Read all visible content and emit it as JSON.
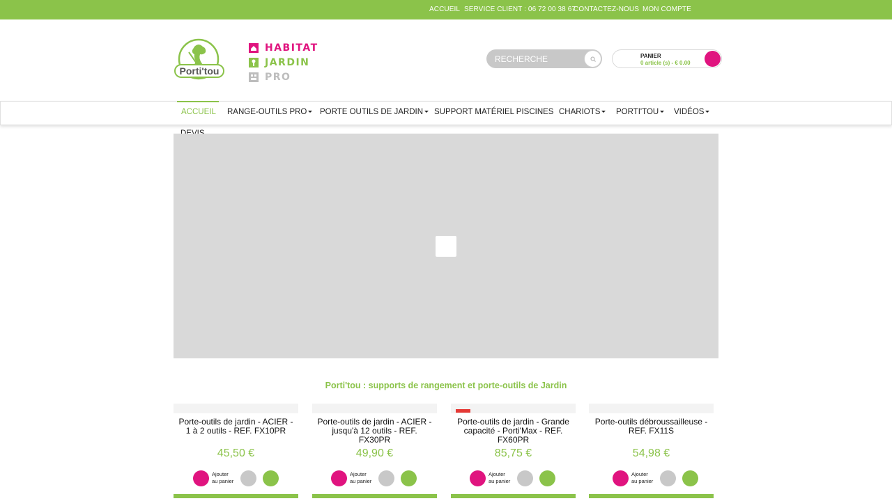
{
  "topbar": {
    "home": "ACCUEIL",
    "service": "SERVICE CLIENT : 06 72 00 38 67",
    "contact": "CONTACTEZ-NOUS",
    "account": "MON COMPTE"
  },
  "logo": {
    "text": "Porti'tou"
  },
  "univers": [
    {
      "label": "HABITAT",
      "color": "#e0147f",
      "icon": "house-icon"
    },
    {
      "label": "JARDIN",
      "color": "#8bc34a",
      "icon": "garden-icon"
    },
    {
      "label": "PRO",
      "color": "#bdbdbd",
      "icon": "building-icon"
    }
  ],
  "search": {
    "placeholder": "RECHERCHE"
  },
  "cart": {
    "title": "PANIER",
    "summary": "0 article (s) - € 0.00"
  },
  "nav": {
    "items": [
      {
        "label": "ACCUEIL"
      },
      {
        "label": "RANGE-OUTILS PRO"
      },
      {
        "label": "PORTE OUTILS DE JARDIN"
      },
      {
        "label": "SUPPORT MATÉRIEL PISCINES"
      },
      {
        "label": "CHARIOTS"
      },
      {
        "label": "PORTI'TOU"
      },
      {
        "label": "VIDÉOS"
      }
    ],
    "devis": "DEVIS"
  },
  "headline": "Porti'tou : supports de rangement et porte-outils de Jardin",
  "products": [
    {
      "name": "Porte-outils de jardin - ACIER - 1 à 2 outils - REF. FX10PR",
      "price": "45,50 €",
      "add_label": "Ajouter au panier"
    },
    {
      "name": "Porte-outils de jardin - ACIER - jusqu'à 12 outils - REF. FX30PR",
      "price": "49,90 €",
      "add_label": "Ajouter au panier"
    },
    {
      "name": "Porte-outils de jardin - Grande capacité - Porti'Max - REF. FX60PR",
      "price": "85,75 €",
      "add_label": "Ajouter au panier"
    },
    {
      "name": "Porte-outils débroussailleuse - REF. FX11S",
      "price": "54,98 €",
      "add_label": "Ajouter au panier"
    }
  ],
  "colors": {
    "brand_green": "#8bc34a",
    "brand_pink": "#e0147f"
  }
}
